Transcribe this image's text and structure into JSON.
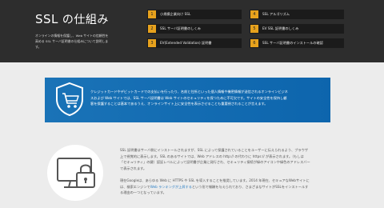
{
  "hero": {
    "title_prefix": "SSL",
    "title_suffix": "の仕組み",
    "desc_lines": [
      "オンラインの情報を保護し、Web サイトの信頼性を",
      "高める SSL サーバ証明書の仕組みについて説明しま",
      "す。"
    ]
  },
  "nav": {
    "left": [
      {
        "num": "1",
        "label": "小規模企業向け SSL"
      },
      {
        "num": "2",
        "label": "SSL サーバ証明書のしくみ"
      },
      {
        "num": "3",
        "label": "EV(Extended Validation) 証明書"
      }
    ],
    "right": [
      {
        "num": "4",
        "label": "SSL アルゴリズム"
      },
      {
        "num": "5",
        "label": "EV SSL 証明書のしくみ"
      },
      {
        "num": "6",
        "label": "SSL サーバ証明書のインストールの確認"
      }
    ]
  },
  "band": {
    "lines": [
      "クレジットカードやデビットカードでの支払いを行ったり、名前と住所といった個人情報や機密情報が送信されるオンラインビジネ",
      "スおよび Web サイトでは、SSL サーバ証明書は Web サイトのセキュリティを保つために不可欠です。サイトの安全性を保持し顧",
      "客を保護することは基本であるうえ、オンラインサイト上に安全性を表示させることも重要視されることが言えます。"
    ]
  },
  "content": {
    "para1": [
      "SSL 証明書はサーバ側にインストールされますが、SSL によって保護されていることをユーザーに伝えられるよう、ブラウザ",
      "上で視覚的に表示します。SSL のあるサイトでは、Web アドレスの http:// の代わりに https:// が表示されます。（もしは",
      "「セキュリティ」の鍵）認証レベルによって証明書が企業に発行され、セキュリティ接続が緑のアイコンや緑色のアドレスバー",
      "で表示されます。"
    ],
    "para2_line1": "現在Googleは、あらゆる Web に HTTPS や SSL を導入することを推奨しています。2014 年現在、セキュアなWebサイトに",
    "para2_line2_pre": "は、検索エンジンで",
    "para2_link": "Web ランキングが上昇する",
    "para2_line2_post": "という形で報酬を与えられており、さまざまなサイトがSSLをインストールす",
    "para2_line3": "る理由の一つとなっています。"
  },
  "colors": {
    "hero_bg": "#2d2d2d",
    "nav_number": "#e7a21d",
    "band_blue": "#1a73b7",
    "link": "#2d7fc4"
  },
  "icons": {
    "band": "shield-cart-icon",
    "content": "computer-lock-icon"
  }
}
